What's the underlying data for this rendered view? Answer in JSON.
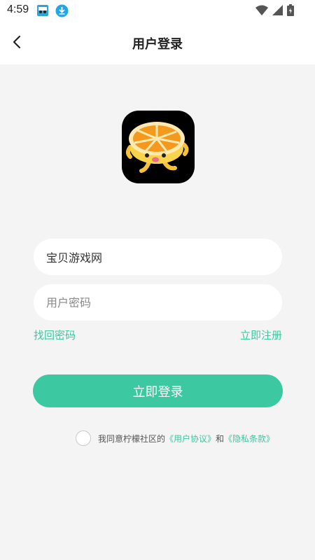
{
  "status_bar": {
    "time": "4:59",
    "icons": [
      "app-notification-icon",
      "download-icon",
      "wifi-icon",
      "cell-signal-icon",
      "battery-icon"
    ]
  },
  "header": {
    "title": "用户登录",
    "back_icon": "chevron-left-icon"
  },
  "logo": {
    "icon": "orange-mascot-logo"
  },
  "form": {
    "username_value": "宝贝游戏网",
    "password_placeholder": "用户密码",
    "forgot_password": "找回密码",
    "register": "立即注册",
    "login_button": "立即登录"
  },
  "agreement": {
    "prefix": "我同意柠檬社区的",
    "user_agreement": "《用户协议》",
    "and": "和",
    "privacy_policy": "《隐私条款》",
    "checked": false
  },
  "colors": {
    "accent": "#3cc8a0",
    "background": "#f4f4f4",
    "card": "#ffffff"
  }
}
